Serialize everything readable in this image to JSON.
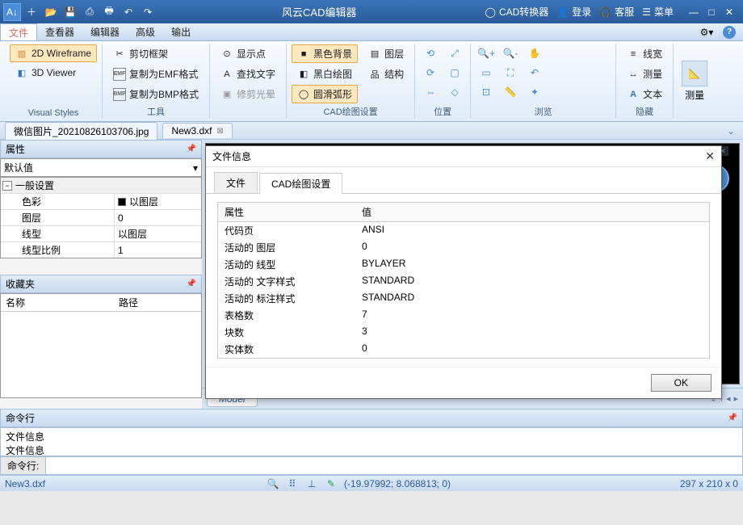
{
  "title_bar": {
    "app_title": "风云CAD编辑器",
    "right": [
      "CAD转换器",
      "登录",
      "客服",
      "菜单"
    ]
  },
  "menu": {
    "items": [
      "文件",
      "查看器",
      "编辑器",
      "高级",
      "输出"
    ]
  },
  "ribbon": {
    "g0": {
      "label": "Visual Styles",
      "b0": "2D Wireframe",
      "b1": "3D Viewer"
    },
    "g1": {
      "label": "工具",
      "b0": "剪切框架",
      "b1": "复制为EMF格式",
      "b2": "复制为BMP格式"
    },
    "g2": {
      "b0": "显示点",
      "b1": "查找文字",
      "b2": "修剪光晕"
    },
    "g3": {
      "label": "CAD绘图设置",
      "b0": "黑色背景",
      "b1": "黑白绘图",
      "b2": "圆滑弧形",
      "b3": "图层",
      "b4": "结构"
    },
    "g4": {
      "label": "位置"
    },
    "g5": {
      "label": "浏览"
    },
    "g6": {
      "label": "隐藏",
      "b0": "线宽",
      "b1": "测量",
      "b2": "文本"
    },
    "g7": {
      "label": "测量"
    }
  },
  "tabs": {
    "t0": "微信图片_20210826103706.jpg",
    "t1": "New3.dxf"
  },
  "panels": {
    "props": {
      "title": "属性",
      "selector": "默认值",
      "group": "一般设置",
      "rows": [
        {
          "k": "色彩",
          "v": "以图层"
        },
        {
          "k": "图层",
          "v": "0"
        },
        {
          "k": "线型",
          "v": "以图层"
        },
        {
          "k": "线型比例",
          "v": "1"
        }
      ]
    },
    "fav": {
      "title": "收藏夹",
      "c0": "名称",
      "c1": "路径"
    },
    "cmd": {
      "title": "命令行",
      "lines": [
        "文件信息",
        "文件信息"
      ],
      "prompt": "命令行:"
    }
  },
  "dialog": {
    "title": "文件信息",
    "tabs": [
      "文件",
      "CAD绘图设置"
    ],
    "columns": [
      "属性",
      "值"
    ],
    "rows": [
      {
        "k": "代码页",
        "v": "ANSI"
      },
      {
        "k": "活动的 图层",
        "v": "0"
      },
      {
        "k": "活动的 线型",
        "v": "BYLAYER"
      },
      {
        "k": "活动的 文字样式",
        "v": "STANDARD"
      },
      {
        "k": "活动的 标注样式",
        "v": "STANDARD"
      },
      {
        "k": "表格数",
        "v": "7"
      },
      {
        "k": "块数",
        "v": "3"
      },
      {
        "k": "实体数",
        "v": "0"
      }
    ],
    "ok": "OK"
  },
  "model": {
    "tab": "Model"
  },
  "status": {
    "file": "New3.dxf",
    "coord": "(-19.97992; 8.068813; 0)",
    "dim": "297 x 210 x 0"
  }
}
